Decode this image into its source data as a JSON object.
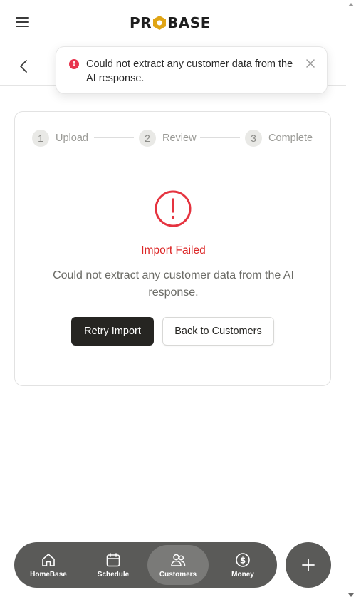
{
  "header": {
    "logo_text": "PROBASE",
    "logo_left": "PR",
    "logo_right": "BASE",
    "menu_icon": "hamburger-menu-icon",
    "back_icon": "chevron-left-icon"
  },
  "toast": {
    "icon": "error-alert-icon",
    "message": "Could not extract any customer data from the AI response.",
    "close_icon": "close-icon"
  },
  "stepper": {
    "steps": [
      {
        "number": "1",
        "label": "Upload"
      },
      {
        "number": "2",
        "label": "Review"
      },
      {
        "number": "3",
        "label": "Complete"
      }
    ]
  },
  "result": {
    "icon": "error-circle-icon",
    "title": "Import Failed",
    "message": "Could not extract any customer data from the AI response.",
    "retry_label": "Retry Import",
    "back_label": "Back to Customers"
  },
  "bottom_nav": {
    "items": [
      {
        "label": "HomeBase",
        "icon": "home-icon",
        "active": false
      },
      {
        "label": "Schedule",
        "icon": "calendar-icon",
        "active": false
      },
      {
        "label": "Customers",
        "icon": "users-icon",
        "active": true
      },
      {
        "label": "Money",
        "icon": "dollar-circle-icon",
        "active": false
      }
    ],
    "fab_icon": "plus-icon"
  },
  "colors": {
    "error": "#dc2626",
    "primary_button": "#262522",
    "nav_background": "#5a5a58",
    "logo_accent": "#e0a516"
  }
}
